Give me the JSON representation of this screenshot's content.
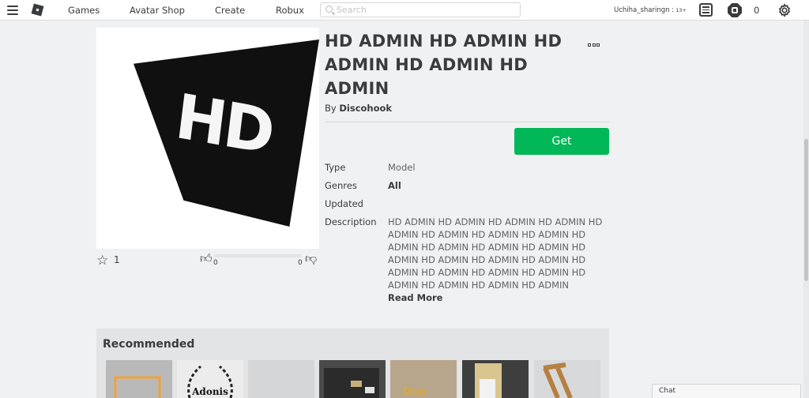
{
  "nav": {
    "items": [
      "Games",
      "Avatar Shop",
      "Create",
      "Robux"
    ],
    "search_placeholder": "Search",
    "username": "Uchiha_sharingn :",
    "age_tag": "13+",
    "robux_balance": "0"
  },
  "item": {
    "title": "HD ADMIN HD ADMIN HD ADMIN HD ADMIN HD ADMIN",
    "by_prefix": "By",
    "creator": "Discohook",
    "get_label": "Get",
    "favorites": "1",
    "upvotes": "0",
    "downvotes": "0",
    "details": {
      "type_label": "Type",
      "type_value": "Model",
      "genres_label": "Genres",
      "genres_value": "All",
      "updated_label": "Updated",
      "description_label": "Description",
      "description": "HD ADMIN HD ADMIN HD ADMIN HD ADMIN HD ADMIN HD ADMIN HD ADMIN HD ADMIN HD ADMIN HD ADMIN HD ADMIN HD ADMIN HD ADMIN HD ADMIN HD ADMIN HD ADMIN HD ADMIN HD ADMIN HD ADMIN HD ADMIN HD ADMIN HD ADMIN HD ADMIN HD ADMIN",
      "read_more": "Read More"
    },
    "thumbnail_text": "HD"
  },
  "recommended": {
    "title": "Recommended",
    "cards": [
      {
        "color": "#b9b9b9"
      },
      {
        "color": "#e8e8e8",
        "logo_text": "Adonis"
      },
      {
        "color": "#c9cbcd"
      },
      {
        "color": "#4a4a4a"
      },
      {
        "color": "#c9b79e",
        "logo_text": "Don"
      },
      {
        "color": "#3e3e3e"
      },
      {
        "color": "#b58042"
      }
    ]
  },
  "chat": {
    "label": "Chat"
  },
  "colors": {
    "get_button": "#02b757",
    "page_bg": "#f0f1f2"
  }
}
